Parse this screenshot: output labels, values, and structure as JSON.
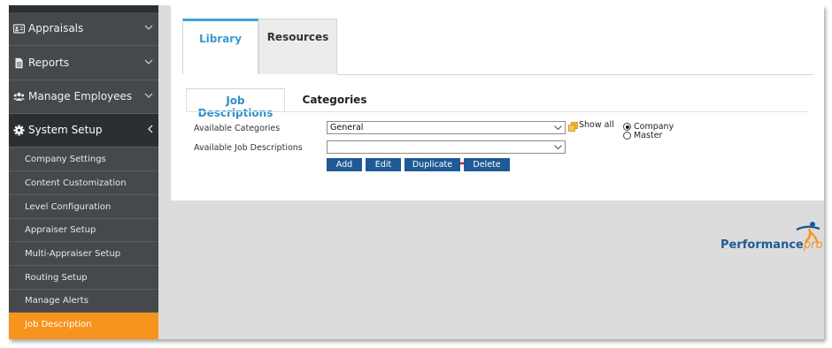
{
  "sidebar": {
    "main_items": [
      {
        "label": "Appraisals",
        "icon": "id-card-icon"
      },
      {
        "label": "Reports",
        "icon": "document-icon"
      },
      {
        "label": "Manage Employees",
        "icon": "users-icon"
      },
      {
        "label": "System Setup",
        "icon": "gear-icon"
      }
    ],
    "sub_items": [
      {
        "label": "Company Settings"
      },
      {
        "label": "Content Customization"
      },
      {
        "label": "Level Configuration"
      },
      {
        "label": "Appraiser Setup"
      },
      {
        "label": "Multi-Appraiser Setup"
      },
      {
        "label": "Routing Setup"
      },
      {
        "label": "Manage Alerts"
      },
      {
        "label": "Job Description"
      }
    ],
    "active_sub_item": "Job Description"
  },
  "tabs": [
    {
      "label": "Library",
      "selected": true
    },
    {
      "label": "Resources",
      "selected": false
    }
  ],
  "subtabs": [
    {
      "label": "Job Descriptions",
      "selected": true
    },
    {
      "label": "Categories",
      "selected": false
    }
  ],
  "form": {
    "available_categories_label": "Available Categories",
    "available_categories_value": "General",
    "available_job_descriptions_label": "Available Job Descriptions",
    "available_job_descriptions_value": "",
    "show_all_label": "Show all",
    "radio_company_label": "Company",
    "radio_master_label": "Master",
    "radio_selected": "Company"
  },
  "buttons": {
    "add": "Add",
    "edit": "Edit",
    "duplicate": "Duplicate",
    "delete": "Delete"
  },
  "logo": {
    "word_main": "Performance",
    "word_suffix": "pro"
  },
  "colors": {
    "sidebar_bg": "#45494c",
    "active_orange": "#f7941d",
    "button_blue": "#1f5a96",
    "tab_accent": "#35a3d8",
    "annotation_arrow": "#e02020"
  }
}
